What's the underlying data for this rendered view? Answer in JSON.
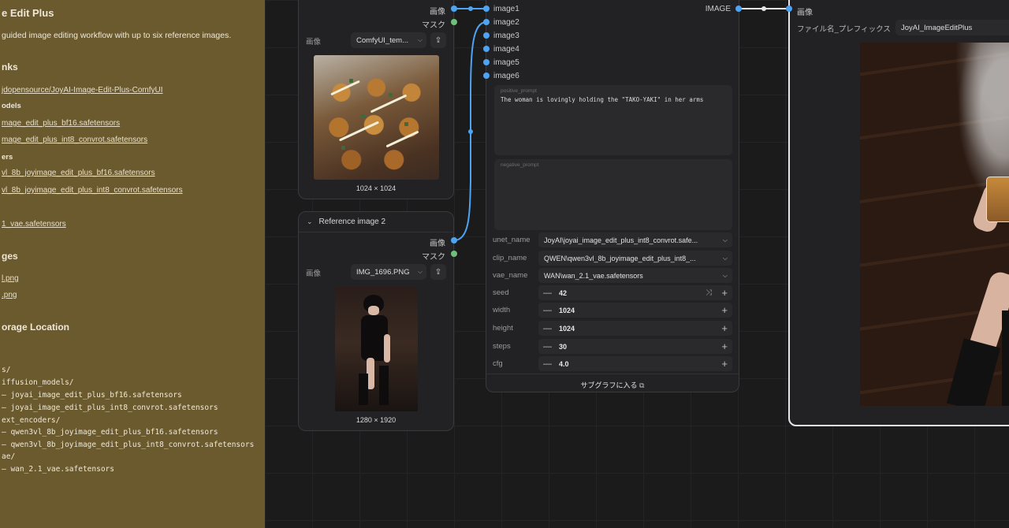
{
  "note": {
    "title": "e Edit Plus",
    "desc": "guided image editing workflow with up to six reference images.",
    "links_heading": "nks",
    "repo_link": "jdopensource/JoyAI-Image-Edit-Plus-ComfyUI",
    "models_heading": "odels",
    "model1": "mage_edit_plus_bf16.safetensors",
    "model2": "mage_edit_plus_int8_convrot.safetensors",
    "encoders_heading": "ers",
    "enc1": "vl_8b_joyimage_edit_plus_bf16.safetensors",
    "enc2": "vl_8b_joyimage_edit_plus_int8_convrot.safetensors",
    "vae": "1_vae.safetensors",
    "images_heading": "ges",
    "img1": "l.png",
    "img2": ".png",
    "storage_heading": "orage Location",
    "tree": [
      "s/",
      "iffusion_models/",
      "— joyai_image_edit_plus_bf16.safetensors",
      "— joyai_image_edit_plus_int8_convrot.safetensors",
      "ext_encoders/",
      "— qwen3vl_8b_joyimage_edit_plus_bf16.safetensors",
      "— qwen3vl_8b_joyimage_edit_plus_int8_convrot.safetensors",
      "ae/",
      "— wan_2.1_vae.safetensors"
    ]
  },
  "ref1": {
    "out_image": "画像",
    "out_mask": "マスク",
    "label": "画像",
    "file": "ComfyUI_tem...",
    "dims": "1024 × 1024"
  },
  "ref2": {
    "title": "Reference image 2",
    "out_image": "画像",
    "out_mask": "マスク",
    "label": "画像",
    "file": "IMG_1696.PNG",
    "dims": "1280 × 1920"
  },
  "subgraph": {
    "inputs": [
      "image1",
      "image2",
      "image3",
      "image4",
      "image5",
      "image6"
    ],
    "output": "IMAGE",
    "positive_placeholder": "positive_prompt",
    "positive_text": "The woman is lovingly holding the \"TAKO-YAKI\" in her arms",
    "negative_placeholder": "negative_prompt",
    "unet_label": "unet_name",
    "unet_value": "JoyAI\\joyai_image_edit_plus_int8_convrot.safe...",
    "clip_label": "clip_name",
    "clip_value": "QWEN\\qwen3vl_8b_joyimage_edit_plus_int8_...",
    "vae_label": "vae_name",
    "vae_value": "WAN\\wan_2.1_vae.safetensors",
    "seed_label": "seed",
    "seed_value": "42",
    "width_label": "width",
    "width_value": "1024",
    "height_label": "height",
    "height_value": "1024",
    "steps_label": "steps",
    "steps_value": "30",
    "cfg_label": "cfg",
    "cfg_value": "4.0",
    "enter_subgraph": "サブグラフに入る"
  },
  "save": {
    "in_label": "画像",
    "prefix_label": "ファイル名_プレフィックス",
    "prefix_value": "JoyAI_ImageEditPlus"
  },
  "colors": {
    "link_blue": "#4ea3f2",
    "mask_green": "#6fc17a",
    "note_bg": "#6b5a2e",
    "selected_border": "#e6e6e6"
  }
}
